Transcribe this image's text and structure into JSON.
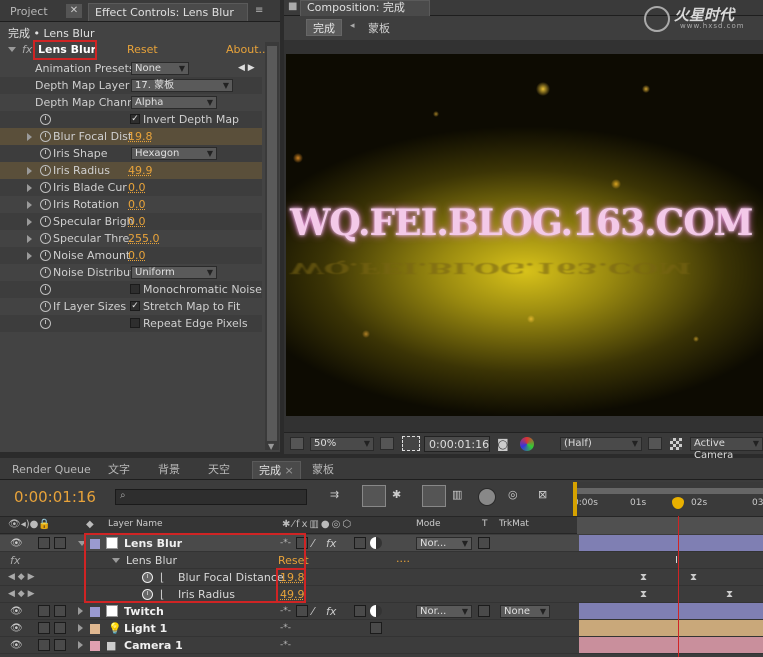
{
  "left_tabs": {
    "project": "Project",
    "effect_controls": "Effect Controls: Lens Blur"
  },
  "breadcrumb": "完成 • Lens Blur",
  "effect": {
    "name": "Lens Blur",
    "reset": "Reset",
    "about": "About..."
  },
  "props": [
    {
      "label": "Animation Presets",
      "value": "None",
      "kind": "dropdown"
    },
    {
      "label": "Depth Map Layer",
      "value": "17. 蒙板",
      "kind": "dropdown"
    },
    {
      "label": "Depth Map Chann",
      "value": "Alpha",
      "kind": "dropdown"
    },
    {
      "label": "",
      "value": "Invert Depth Map",
      "kind": "checkbox",
      "checked": true
    },
    {
      "label": "Blur Focal Dist",
      "value": "19.8",
      "kind": "number"
    },
    {
      "label": "Iris Shape",
      "value": "Hexagon",
      "kind": "dropdown"
    },
    {
      "label": "Iris Radius",
      "value": "49.9",
      "kind": "number"
    },
    {
      "label": "Iris Blade Cur",
      "value": "0.0",
      "kind": "number"
    },
    {
      "label": "Iris Rotation",
      "value": "0.0",
      "kind": "number"
    },
    {
      "label": "Specular Brigh",
      "value": "0.0",
      "kind": "number"
    },
    {
      "label": "Specular Thre",
      "value": "255.0",
      "kind": "number"
    },
    {
      "label": "Noise Amount",
      "value": "0.0",
      "kind": "number"
    },
    {
      "label": "Noise Distribut",
      "value": "Uniform",
      "kind": "dropdown"
    },
    {
      "label": "",
      "value": "Monochromatic Noise",
      "kind": "checkbox",
      "checked": false
    },
    {
      "label": "If Layer Sizes",
      "value": "Stretch Map to Fit",
      "kind": "checkbox",
      "checked": true
    },
    {
      "label": "",
      "value": "Repeat Edge Pixels",
      "kind": "checkbox",
      "checked": false
    }
  ],
  "comp": {
    "tab": "Composition: 完成",
    "breadcrumb_a": "完成",
    "breadcrumb_b": "蒙板",
    "logo": "火星时代",
    "logo_url": "www.hxsd.com",
    "overlay_text": "WQ.FEI.BLOG.163.COM",
    "zoom": "50%",
    "timecode": "0:00:01:16",
    "resolution": "(Half)",
    "camera": "Active Camera"
  },
  "bottom_tabs": [
    "Render Queue",
    "文字",
    "背景",
    "天空",
    "完成",
    "蒙板"
  ],
  "timeline": {
    "timecode": "0:00:01:16",
    "search_placeholder": "",
    "headers": {
      "layer_name": "Layer Name",
      "mode": "Mode",
      "t": "T",
      "trkmat": "TrkMat"
    },
    "ruler": [
      "0:00s",
      "01s",
      "02s",
      "03"
    ],
    "rows": [
      {
        "name": "Lens Blur",
        "mode": "Nor...",
        "bold": true
      },
      {
        "name": "Lens Blur",
        "reset": "Reset",
        "dots": "...."
      },
      {
        "name": "Blur Focal Distance",
        "value": "19.8"
      },
      {
        "name": "Iris Radius",
        "value": "49.9"
      },
      {
        "name": "Twitch",
        "mode": "Nor...",
        "trkmat": "None",
        "bold": true
      },
      {
        "name": "Light 1",
        "bold": true
      },
      {
        "name": "Camera 1",
        "bold": true
      }
    ]
  },
  "colors": {
    "accent": "#e8a33a",
    "highlight_red": "#d02424",
    "playhead": "#d02424",
    "bar_purple": "#7f7fb3",
    "bar_tan": "#c9a87a",
    "bar_pink": "#c98f9c"
  }
}
